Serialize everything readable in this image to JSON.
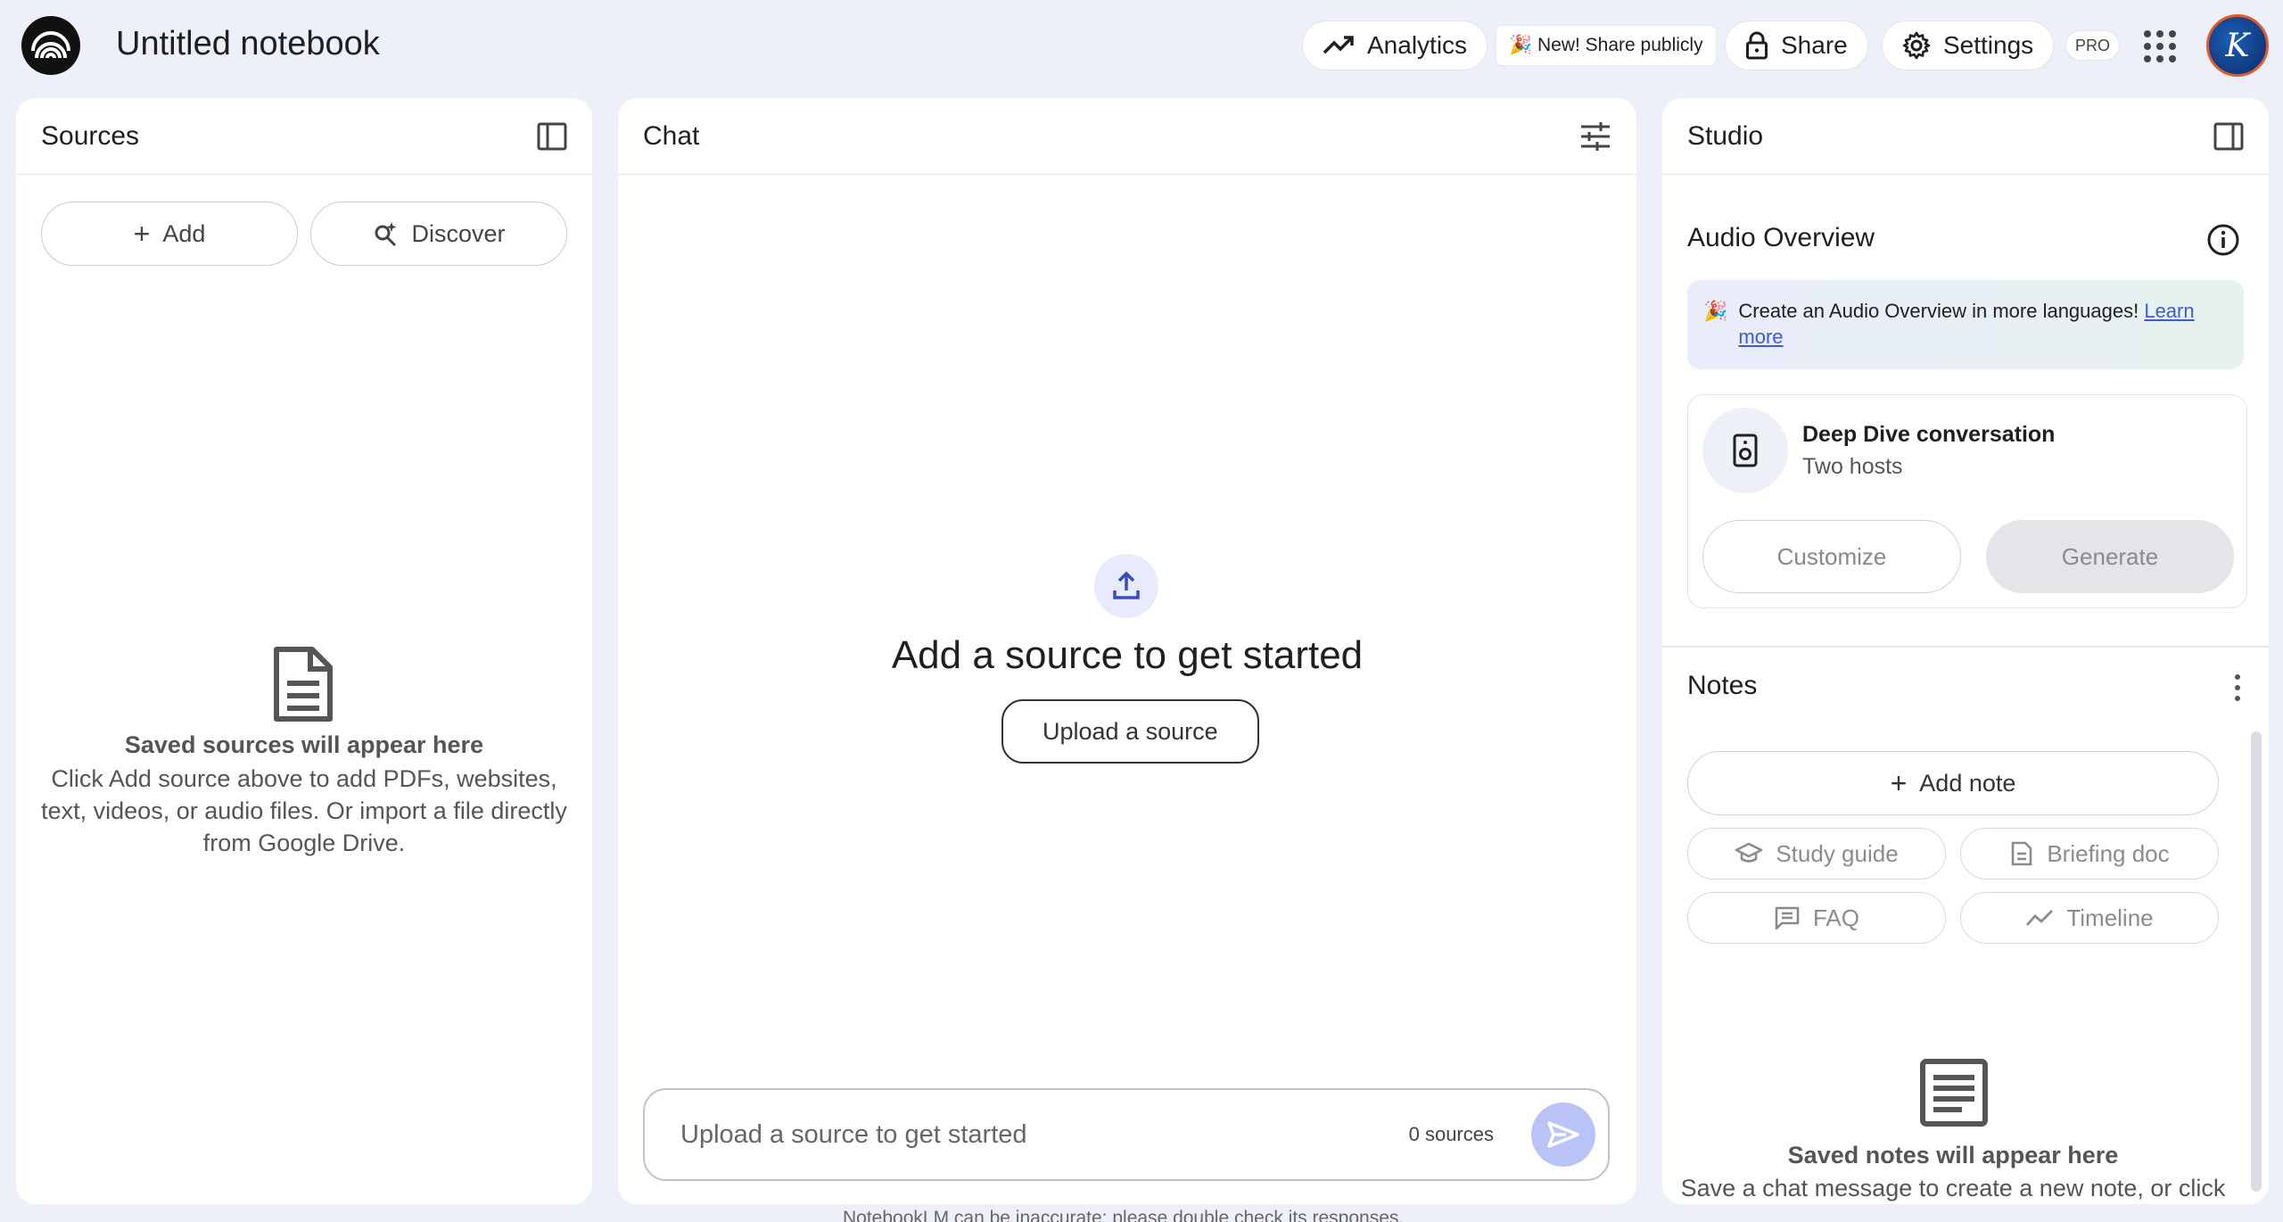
{
  "header": {
    "notebook_title": "Untitled notebook",
    "analytics_label": "Analytics",
    "share_publicly_label": "🎉 New! Share publicly",
    "share_label": "Share",
    "settings_label": "Settings",
    "pro_badge": "PRO",
    "avatar_initial": "K"
  },
  "sources": {
    "title": "Sources",
    "add_label": "Add",
    "discover_label": "Discover",
    "empty_title": "Saved sources will appear here",
    "empty_line1": "Click Add source above to add PDFs, websites,",
    "empty_line2": "text, videos, or audio files. Or import a file directly",
    "empty_line3": "from Google Drive."
  },
  "chat": {
    "title": "Chat",
    "heading": "Add a source to get started",
    "upload_button": "Upload a source",
    "input_placeholder": "Upload a source to get started",
    "source_count": "0 sources"
  },
  "studio": {
    "title": "Studio",
    "audio_overview_title": "Audio Overview",
    "banner_emoji": "🎉",
    "banner_text": "Create an Audio Overview in more languages! ",
    "banner_link": "Learn more",
    "deep_dive_title": "Deep Dive conversation",
    "deep_dive_subtitle": "Two hosts",
    "customize_label": "Customize",
    "generate_label": "Generate",
    "notes_title": "Notes",
    "add_note_label": "Add note",
    "chips": [
      "Study guide",
      "Briefing doc",
      "FAQ",
      "Timeline"
    ],
    "notes_empty_title": "Saved notes will appear here",
    "notes_empty_text": "Save a chat message to create a new note, or click"
  },
  "footer": {
    "disclaimer": "NotebookLM can be inaccurate; please double check its responses."
  },
  "colors": {
    "page_bg": "#eef0f9",
    "send_button": "#b9c3f7",
    "link": "#3b5bdb"
  }
}
